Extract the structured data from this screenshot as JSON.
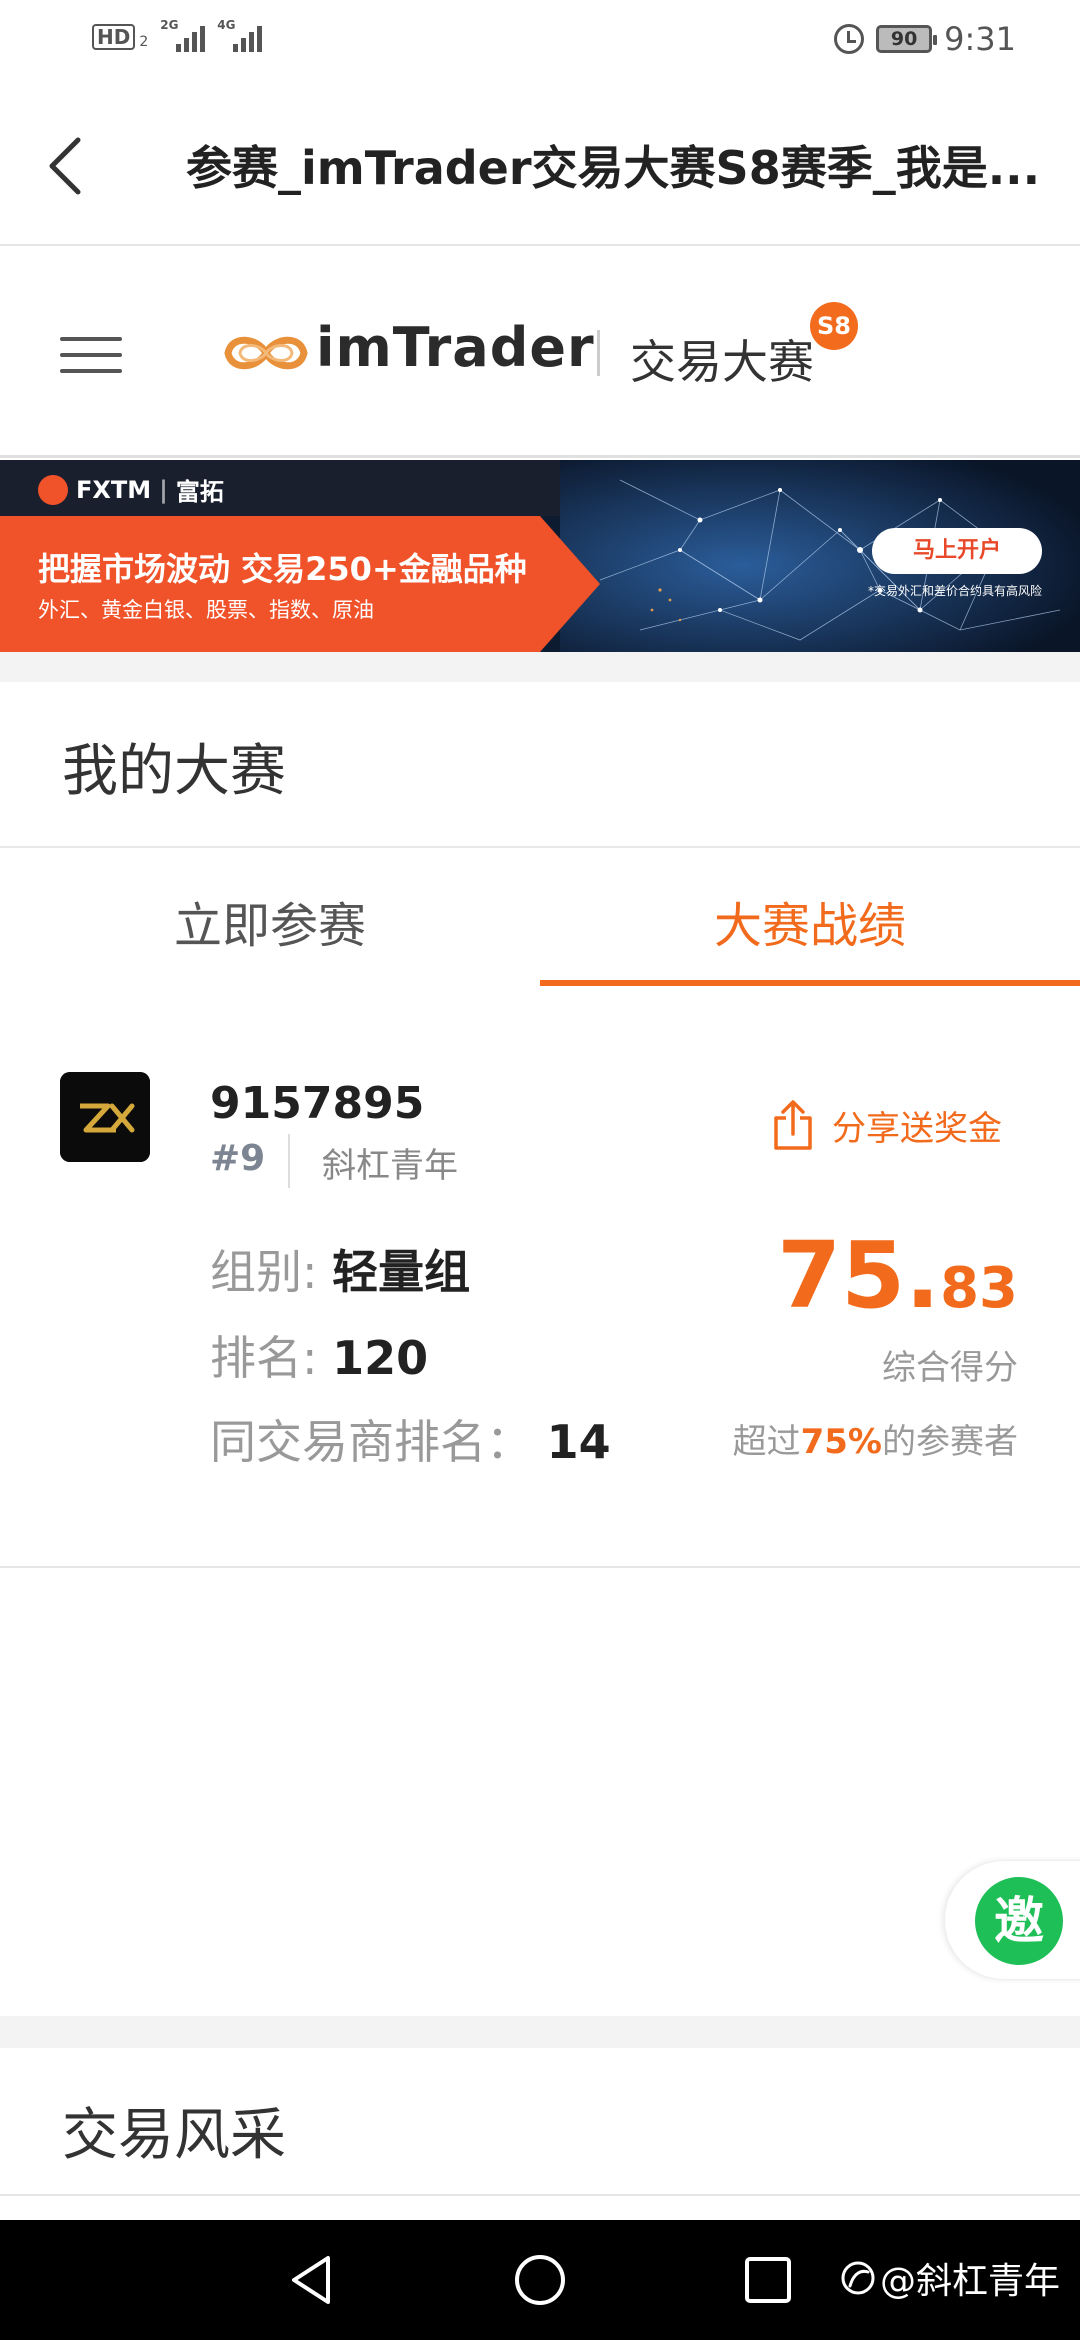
{
  "status_bar": {
    "network": {
      "hd": "HD",
      "hd_sub": "2",
      "sim1": "2G",
      "sim2": "4G"
    },
    "battery": "90",
    "time": "9:31"
  },
  "title_bar": {
    "title": "参赛_imTrader交易大赛S8赛季_我是..."
  },
  "site_header": {
    "logo_text": "imTrader",
    "logo_sub": "交易大赛",
    "season_badge": "S8",
    "brand_color": "#f26a1b"
  },
  "ad_banner": {
    "brand": "FXTM",
    "brand_cn": "富拓",
    "headline": "把握市场波动 交易250+金融品种",
    "subline": "外汇、黄金白银、股票、指数、原油",
    "cta": "马上开户",
    "note": "*交易外汇和差价合约具有高风险"
  },
  "my_contest": {
    "title": "我的大赛",
    "tabs": [
      {
        "label": "立即参赛",
        "active": false
      },
      {
        "label": "大赛战绩",
        "active": true
      }
    ],
    "account": {
      "id": "9157895",
      "rank_tag": "#9",
      "nickname": "斜杠青年",
      "share_label": "分享送奖金"
    },
    "stats": {
      "group_label": "组别:",
      "group_value": "轻量组",
      "rank_label": "排名:",
      "rank_value": "120",
      "broker_rank_label": "同交易商排名：",
      "broker_rank_value": "14"
    },
    "score": {
      "int_part": "75.",
      "dec_part": "83",
      "label": "综合得分",
      "beat_prefix": "超过",
      "beat_percent": "75%",
      "beat_suffix": "的参赛者"
    }
  },
  "invite_button": {
    "label": "邀"
  },
  "trade_style": {
    "title": "交易风采"
  },
  "watermark": {
    "text": "@斜杠青年"
  }
}
